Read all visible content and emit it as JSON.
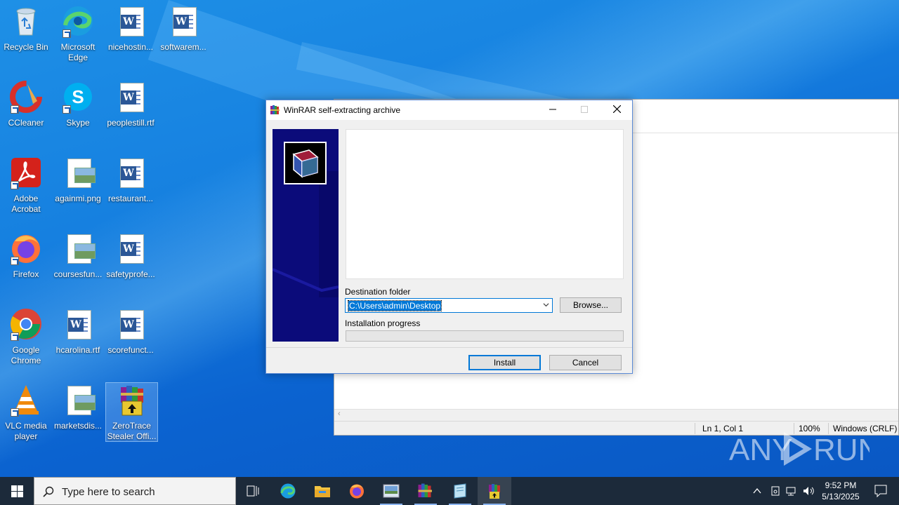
{
  "desktop": {
    "icons": [
      {
        "label": "Recycle Bin",
        "icon": "recycle-bin-icon"
      },
      {
        "label": "Microsoft Edge",
        "icon": "edge-icon"
      },
      {
        "label": "nicehostin...",
        "icon": "word-doc-icon"
      },
      {
        "label": "softwarem...",
        "icon": "word-doc-icon"
      },
      {
        "label": "CCleaner",
        "icon": "ccleaner-icon"
      },
      {
        "label": "Skype",
        "icon": "skype-icon"
      },
      {
        "label": "peoplestill.rtf",
        "icon": "word-doc-icon"
      },
      {
        "label": "Adobe Acrobat",
        "icon": "acrobat-icon"
      },
      {
        "label": "againmi.png",
        "icon": "image-file-icon"
      },
      {
        "label": "restaurant...",
        "icon": "word-doc-icon"
      },
      {
        "label": "Firefox",
        "icon": "firefox-icon"
      },
      {
        "label": "coursesfun...",
        "icon": "image-file-icon"
      },
      {
        "label": "safetyprofe...",
        "icon": "word-doc-icon"
      },
      {
        "label": "Google Chrome",
        "icon": "chrome-icon"
      },
      {
        "label": "hcarolina.rtf",
        "icon": "word-doc-icon"
      },
      {
        "label": "scorefunct...",
        "icon": "word-doc-icon"
      },
      {
        "label": "VLC media player",
        "icon": "vlc-icon"
      },
      {
        "label": "marketsdis...",
        "icon": "image-file-icon"
      },
      {
        "label": "ZeroTrace Stealer Offi...",
        "icon": "winrar-sfx-icon"
      }
    ]
  },
  "notepad": {
    "status_position": "Ln 1, Col 1",
    "status_zoom": "100%",
    "status_encoding": "Windows (CRLF)"
  },
  "dialog": {
    "title": "WinRAR self-extracting archive",
    "destination_label": "Destination folder",
    "destination_value": "C:\\Users\\admin\\Desktop",
    "browse_label": "Browse...",
    "progress_label": "Installation progress",
    "progress_fraction": 0,
    "install_label": "Install",
    "cancel_label": "Cancel"
  },
  "watermark": "ANY RUN",
  "taskbar": {
    "search_placeholder": "Type here to search",
    "apps": [
      "task-view-icon",
      "edge-icon",
      "file-explorer-icon",
      "firefox-icon",
      "image-viewer-icon",
      "winrar-icon",
      "notepad-icon",
      "winrar-sfx-icon"
    ],
    "time": "9:52 PM",
    "date": "5/13/2025"
  }
}
